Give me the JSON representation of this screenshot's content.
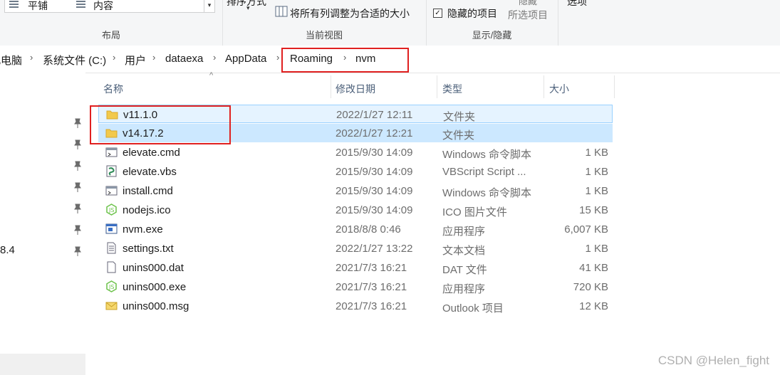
{
  "ribbon": {
    "layout": {
      "label": "布局",
      "items": [
        "平铺",
        "内容"
      ]
    },
    "current_view": {
      "label": "当前视图",
      "sort_label": "排序方式",
      "fit_columns": "将所有列调整为合适的大小"
    },
    "show_hide": {
      "label": "显示/隐藏",
      "hidden_items": "隐藏的项目",
      "hide_label": "隐藏",
      "selected_items": "所选项目"
    },
    "options": "选项"
  },
  "breadcrumb": [
    "此电脑",
    "系统文件 (C:)",
    "用户",
    "dataexa",
    "AppData",
    "Roaming",
    "nvm"
  ],
  "nav": {
    "partial_item": "8.4"
  },
  "columns": {
    "name": "名称",
    "date": "修改日期",
    "type": "类型",
    "size": "大小"
  },
  "files": [
    {
      "name": "v11.1.0",
      "date": "2022/1/27 12:11",
      "type": "文件夹",
      "size": "",
      "icon": "folder-icon"
    },
    {
      "name": "v14.17.2",
      "date": "2022/1/27 12:21",
      "type": "文件夹",
      "size": "",
      "icon": "folder-icon"
    },
    {
      "name": "elevate.cmd",
      "date": "2015/9/30 14:09",
      "type": "Windows 命令脚本",
      "size": "1 KB",
      "icon": "cmd-file-icon"
    },
    {
      "name": "elevate.vbs",
      "date": "2015/9/30 14:09",
      "type": "VBScript Script ...",
      "size": "1 KB",
      "icon": "vbs-file-icon"
    },
    {
      "name": "install.cmd",
      "date": "2015/9/30 14:09",
      "type": "Windows 命令脚本",
      "size": "1 KB",
      "icon": "cmd-file-icon"
    },
    {
      "name": "nodejs.ico",
      "date": "2015/9/30 14:09",
      "type": "ICO 图片文件",
      "size": "15 KB",
      "icon": "node-icon"
    },
    {
      "name": "nvm.exe",
      "date": "2018/8/8 0:46",
      "type": "应用程序",
      "size": "6,007 KB",
      "icon": "exe-icon"
    },
    {
      "name": "settings.txt",
      "date": "2022/1/27 13:22",
      "type": "文本文档",
      "size": "1 KB",
      "icon": "text-file-icon"
    },
    {
      "name": "unins000.dat",
      "date": "2021/7/3 16:21",
      "type": "DAT 文件",
      "size": "41 KB",
      "icon": "blank-file-icon"
    },
    {
      "name": "unins000.exe",
      "date": "2021/7/3 16:21",
      "type": "应用程序",
      "size": "720 KB",
      "icon": "node-icon"
    },
    {
      "name": "unins000.msg",
      "date": "2021/7/3 16:21",
      "type": "Outlook 项目",
      "size": "12 KB",
      "icon": "mail-icon"
    }
  ],
  "watermark": "CSDN @Helen_fight",
  "colors": {
    "selection": "#cce8ff",
    "highlight_box": "#e02020",
    "folder": "#f2c94c"
  }
}
